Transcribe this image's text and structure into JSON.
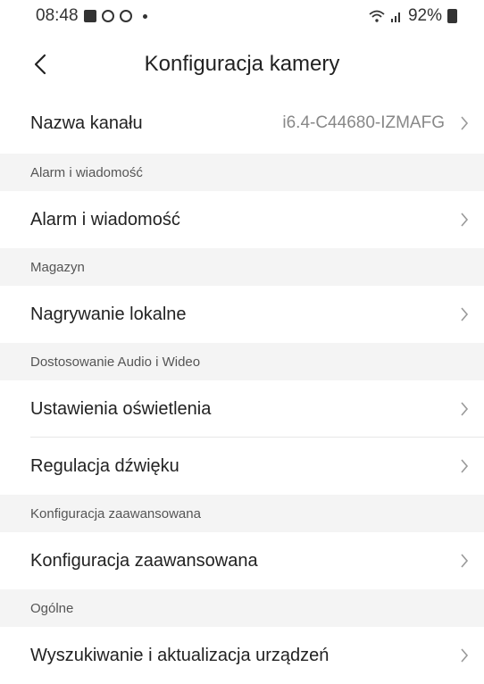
{
  "status": {
    "time": "08:48",
    "battery": "92%"
  },
  "header": {
    "title": "Konfiguracja kamery"
  },
  "rows": {
    "channel_name": {
      "label": "Nazwa kanału",
      "value": "i6.4-C44680-IZMAFG"
    },
    "alarm": {
      "label": "Alarm i wiadomość"
    },
    "local_recording": {
      "label": "Nagrywanie lokalne"
    },
    "lighting": {
      "label": "Ustawienia oświetlenia"
    },
    "sound": {
      "label": "Regulacja dźwięku"
    },
    "advanced": {
      "label": "Konfiguracja zaawansowana"
    },
    "device_search": {
      "label": "Wyszukiwanie i aktualizacja urządzeń"
    }
  },
  "sections": {
    "alarm": "Alarm i wiadomość",
    "storage": "Magazyn",
    "av": "Dostosowanie Audio i Wideo",
    "advanced": "Konfiguracja zaawansowana",
    "general": "Ogólne"
  },
  "icons": [
    "image-icon",
    "g-icon",
    "dot-icon",
    "wifi-icon",
    "signal-icon",
    "battery-icon",
    "back-arrow-icon",
    "chevron-right-icon"
  ]
}
